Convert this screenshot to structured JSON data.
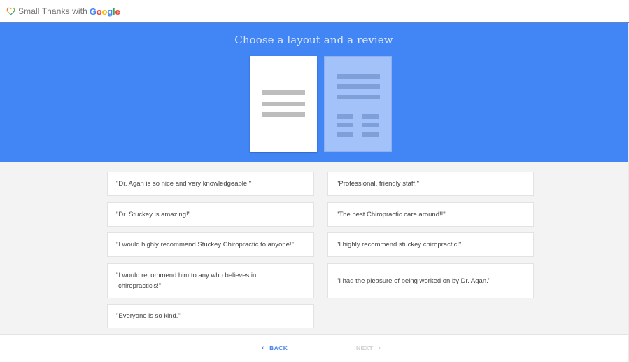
{
  "header": {
    "app_name": "Small Thanks with",
    "brand": {
      "letters": [
        "G",
        "o",
        "o",
        "g",
        "l",
        "e"
      ],
      "colors": [
        "#4285f4",
        "#ea4335",
        "#fbbc05",
        "#4285f4",
        "#34a853",
        "#ea4335"
      ]
    },
    "logo_icon": "heart-outline-icon"
  },
  "hero": {
    "title": "Choose a layout and a review",
    "background_color": "#4285f4",
    "layouts": [
      {
        "name": "single-review-layout",
        "selected": true
      },
      {
        "name": "multi-review-layout",
        "selected": false
      }
    ]
  },
  "reviews": {
    "left": [
      "\"Dr. Agan is so nice and very knowledgeable.\"",
      "\"Dr. Stuckey is amazing!\"",
      "\"I would highly recommend Stuckey Chiropractic to anyone!\"",
      "\"I would recommend him to any who believes in chiropractic's!\"",
      "\"Everyone is so kind.\""
    ],
    "left_multiline": {
      "line1": "\"I would recommend him to any who believes in",
      "line2": "chiropractic's!\""
    },
    "right": [
      "\"Professional, friendly staff.\"",
      "\"The best Chiropractic care around!!\"",
      "\"I highly recommend stuckey chiropractic!\"",
      "\"I had the pleasure of being worked on by Dr. Agan.\""
    ]
  },
  "footer": {
    "back_label": "BACK",
    "next_label": "NEXT",
    "back_icon": "chevron-left-icon",
    "next_icon": "chevron-right-icon",
    "next_enabled": false,
    "accent_color": "#4a86ea"
  }
}
